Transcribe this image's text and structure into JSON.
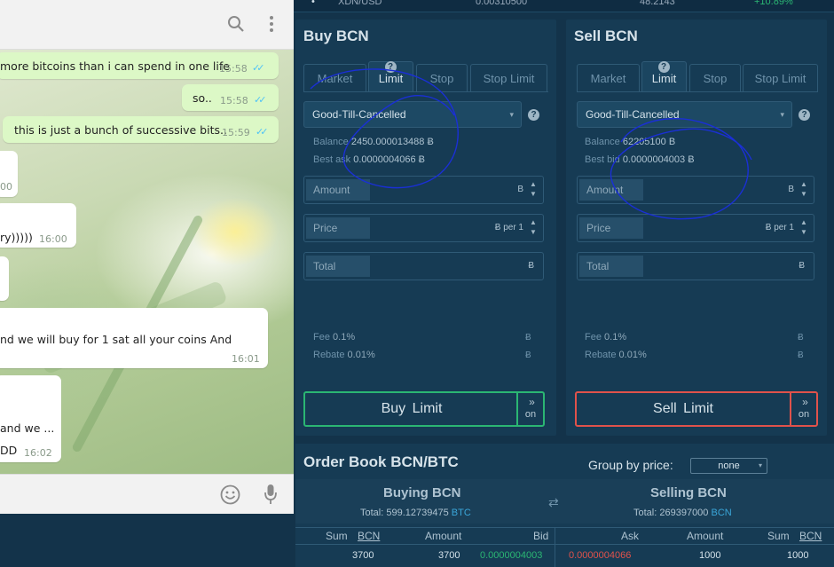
{
  "chat": {
    "header_icons": [
      "search-icon",
      "more-vertical-icon"
    ],
    "footer_icons": [
      "emoji-icon",
      "microphone-icon"
    ],
    "messages": [
      {
        "text": "more bitcoins than i can spend in one life",
        "time": "15:58",
        "status": "read"
      },
      {
        "text": "so..",
        "time": "15:58",
        "status": "read"
      },
      {
        "text": "this is just a bunch of successive bits..",
        "time": "15:59",
        "status": "read"
      },
      {
        "text": "",
        "time": "00"
      },
      {
        "text": "ry)))))",
        "time": "16:00"
      },
      {
        "text": "nd we will buy for 1 sat all your coins And",
        "time": "16:01"
      },
      {
        "text": "and we ...",
        "line2": "DD",
        "time": "16:02"
      }
    ]
  },
  "topbar": {
    "pair": "XDN/USD",
    "price": "0.00310500",
    "volume": "48.2143",
    "change": "+10.89%"
  },
  "buy": {
    "title": "Buy BCN",
    "tabs": [
      "Market",
      "Limit",
      "Stop",
      "Stop Limit"
    ],
    "active_tab": "Limit",
    "tab_help": "?",
    "order_type": "Good-Till-Cancelled",
    "help": "?",
    "balance_label": "Balance",
    "balance_value": "2450.000013488 Ƀ",
    "best_label": "Best ask",
    "best_value": "0.0000004066 Ƀ",
    "amount_label": "Amount",
    "amount_unit": "B",
    "price_label": "Price",
    "price_unit": "Ƀ per 1",
    "total_label": "Total",
    "total_unit": "Ƀ",
    "fee_label": "Fee",
    "fee_value": "0.1%",
    "fee_unit": "Ƀ",
    "rebate_label": "Rebate",
    "rebate_value": "0.01%",
    "rebate_unit": "Ƀ",
    "action_label": "Buy  Limit",
    "action_side": "on",
    "accent": "#2bb673"
  },
  "sell": {
    "title": "Sell BCN",
    "tabs": [
      "Market",
      "Limit",
      "Stop",
      "Stop Limit"
    ],
    "active_tab": "Limit",
    "tab_help": "?",
    "order_type": "Good-Till-Cancelled",
    "help": "?",
    "balance_label": "Balance",
    "balance_value": "62205100 B",
    "best_label": "Best bid",
    "best_value": "0.0000004003 Ƀ",
    "amount_label": "Amount",
    "amount_unit": "B",
    "price_label": "Price",
    "price_unit": "Ƀ per 1",
    "total_label": "Total",
    "total_unit": "Ƀ",
    "fee_label": "Fee",
    "fee_value": "0.1%",
    "fee_unit": "Ƀ",
    "rebate_label": "Rebate",
    "rebate_value": "0.01%",
    "rebate_unit": "Ƀ",
    "action_label": "Sell  Limit",
    "action_side": "on",
    "accent": "#e0524b"
  },
  "orderbook": {
    "title": "Order Book BCN/BTC",
    "group_label": "Group by price:",
    "group_value": "none",
    "buying_title": "Buying BCN",
    "buying_total_label": "Total:",
    "buying_total_value": "599.12739475",
    "buying_total_cur": "BTC",
    "selling_title": "Selling BCN",
    "selling_total_label": "Total:",
    "selling_total_value": "269397000",
    "selling_total_cur": "BCN",
    "columns_left": [
      "Sum",
      "BCN",
      "Amount",
      "Bid"
    ],
    "columns_right": [
      "Ask",
      "Amount",
      "Sum",
      "BCN"
    ],
    "row": {
      "sum_left": "3700",
      "amount_left": "3700",
      "bid": "0.0000004003",
      "ask": "0.0000004066",
      "amount_right": "1000",
      "sum_right": "1000"
    }
  },
  "annotations": {
    "scribble_color": "#1a2fd6"
  }
}
